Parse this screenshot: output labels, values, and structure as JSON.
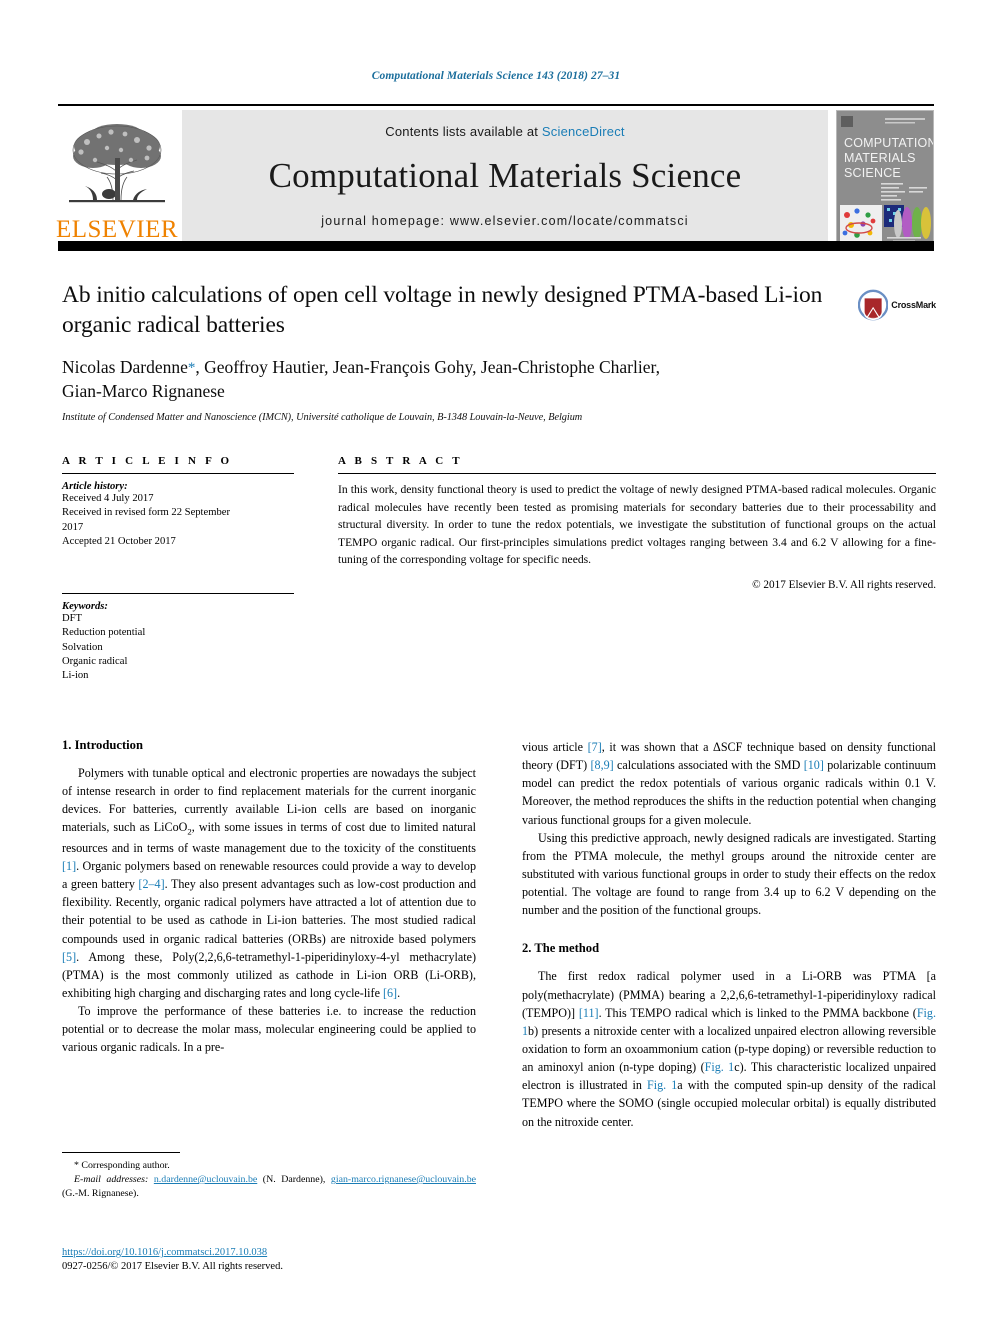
{
  "running_head": "Computational Materials Science 143 (2018) 27–31",
  "masthead": {
    "publisher_name": "ELSEVIER",
    "contents_prefix": "Contents lists available at ",
    "sciencedirect": "ScienceDirect",
    "journal_title": "Computational Materials Science",
    "homepage_line": "journal homepage: www.elsevier.com/locate/commatsci",
    "cover_title_line1": "COMPUTATIONAL",
    "cover_title_line2": "MATERIALS",
    "cover_title_line3": "SCIENCE"
  },
  "article": {
    "title": "Ab initio calculations of open cell voltage in newly designed PTMA-based Li-ion organic radical batteries",
    "authors_line1": "Nicolas Dardenne",
    "corresponding_marker": "*",
    "authors_line1_rest": ", Geoffroy Hautier, Jean-François Gohy, Jean-Christophe Charlier,",
    "authors_line2": "Gian-Marco Rignanese",
    "affiliation": "Institute of Condensed Matter and Nanoscience (IMCN), Université catholique de Louvain, B-1348 Louvain-la-Neuve, Belgium",
    "crossmark_label": "CrossMark"
  },
  "info": {
    "section_label": "A R T I C L E   I N F O",
    "history_label": "Article history:",
    "history": [
      "Received 4 July 2017",
      "Received in revised form 22 September",
      "2017",
      "Accepted 21 October 2017"
    ],
    "keywords_label": "Keywords:",
    "keywords": [
      "DFT",
      "Reduction potential",
      "Solvation",
      "Organic radical",
      "Li-ion"
    ]
  },
  "abstract": {
    "section_label": "A B S T R A C T",
    "text": "In this work, density functional theory is used to predict the voltage of newly designed PTMA-based radical molecules. Organic radical molecules have recently been tested as promising materials for secondary batteries due to their processability and structural diversity. In order to tune the redox potentials, we investigate the substitution of functional groups on the actual TEMPO organic radical. Our first-principles simulations predict voltages ranging between 3.4 and 6.2 V allowing for a fine-tuning of the corresponding voltage for specific needs.",
    "copyright": "© 2017 Elsevier B.V. All rights reserved."
  },
  "body": {
    "intro_heading": "1. Introduction",
    "intro_p1_a": "Polymers with tunable optical and electronic properties are nowadays the subject of intense research in order to find replacement materials for the current inorganic devices. For batteries, currently available Li-ion cells are based on inorganic materials, such as LiCoO",
    "intro_p1_sub": "2",
    "intro_p1_b": ", with some issues in terms of cost due to limited natural resources and in terms of waste management due to the toxicity of the constituents ",
    "ref1": "[1]",
    "intro_p1_c": ". Organic polymers based on renewable resources could provide a way to develop a green battery ",
    "ref2": "[2–4]",
    "intro_p1_d": ". They also present advantages such as low-cost production and flexibility. Recently, organic radical polymers have attracted a lot of attention due to their potential to be used as cathode in Li-ion batteries. The most studied radical compounds used in organic radical batteries (ORBs) are nitroxide based polymers ",
    "ref5": "[5]",
    "intro_p1_e": ". Among these, Poly(2,2,6,6-tetramethyl-1-piperidinyloxy-4-yl methacrylate) (PTMA) is the most commonly utilized as cathode in Li-ion ORB (Li-ORB), exhibiting high charging and discharging rates and long cycle-life ",
    "ref6": "[6]",
    "intro_p1_f": ".",
    "intro_p2": "To improve the performance of these batteries i.e. to increase the reduction potential or to decrease the molar mass, molecular engineering could be applied to various organic radicals. In a pre-",
    "right_p1_a": "vious article ",
    "ref7": "[7]",
    "right_p1_b": ", it was shown that a ΔSCF technique based on density functional theory (DFT) ",
    "ref89": "[8,9]",
    "right_p1_c": " calculations associated with the SMD ",
    "ref10": "[10]",
    "right_p1_d": " polarizable continuum model can predict the redox potentials of various organic radicals within 0.1 V. Moreover, the method reproduces the shifts in the reduction potential when changing various functional groups for a given molecule.",
    "right_p2": "Using this predictive approach, newly designed radicals are investigated. Starting from the PTMA molecule, the methyl groups around the nitroxide center are substituted with various functional groups in order to study their effects on the redox potential. The voltage are found to range from 3.4 up to 6.2 V depending on the number and the position of the functional groups.",
    "method_heading": "2. The method",
    "method_p1_a": "The first redox radical polymer used in a Li-ORB was PTMA [a poly(methacrylate) (PMMA) bearing a 2,2,6,6-tetramethyl-1-piperidinyloxy radical (TEMPO)] ",
    "ref11": "[11]",
    "method_p1_b": ". This TEMPO radical which is linked to the PMMA backbone (",
    "fig1b": "Fig. 1",
    "method_p1_c": "b) presents a nitroxide center with a localized unpaired electron allowing reversible oxidation to form an oxoammonium cation (p-type doping) or reversible reduction to an aminoxyl anion (n-type doping) (",
    "fig1c": "Fig. 1",
    "method_p1_d": "c). This characteristic localized unpaired electron is illustrated in ",
    "fig1a": "Fig. 1",
    "method_p1_e": "a with the computed spin-up density of the radical TEMPO where the SOMO (single occupied molecular orbital) is equally distributed on the nitroxide center."
  },
  "footnote": {
    "corresponding": "* Corresponding author.",
    "email_label": "E-mail addresses:",
    "email1": "n.dardenne@uclouvain.be",
    "email1_owner": " (N. Dardenne), ",
    "email2": "gian-marco.rignanese@uclouvain.be",
    "email2_owner": " (G.-M. Rignanese).",
    "doi": "https://doi.org/10.1016/j.commatsci.2017.10.038",
    "issn": "0927-0256/© 2017 Elsevier B.V. All rights reserved."
  },
  "colors": {
    "link": "#1a7db6",
    "elsevier_orange": "#ef8200",
    "band_gray": "#e6e6e6"
  }
}
